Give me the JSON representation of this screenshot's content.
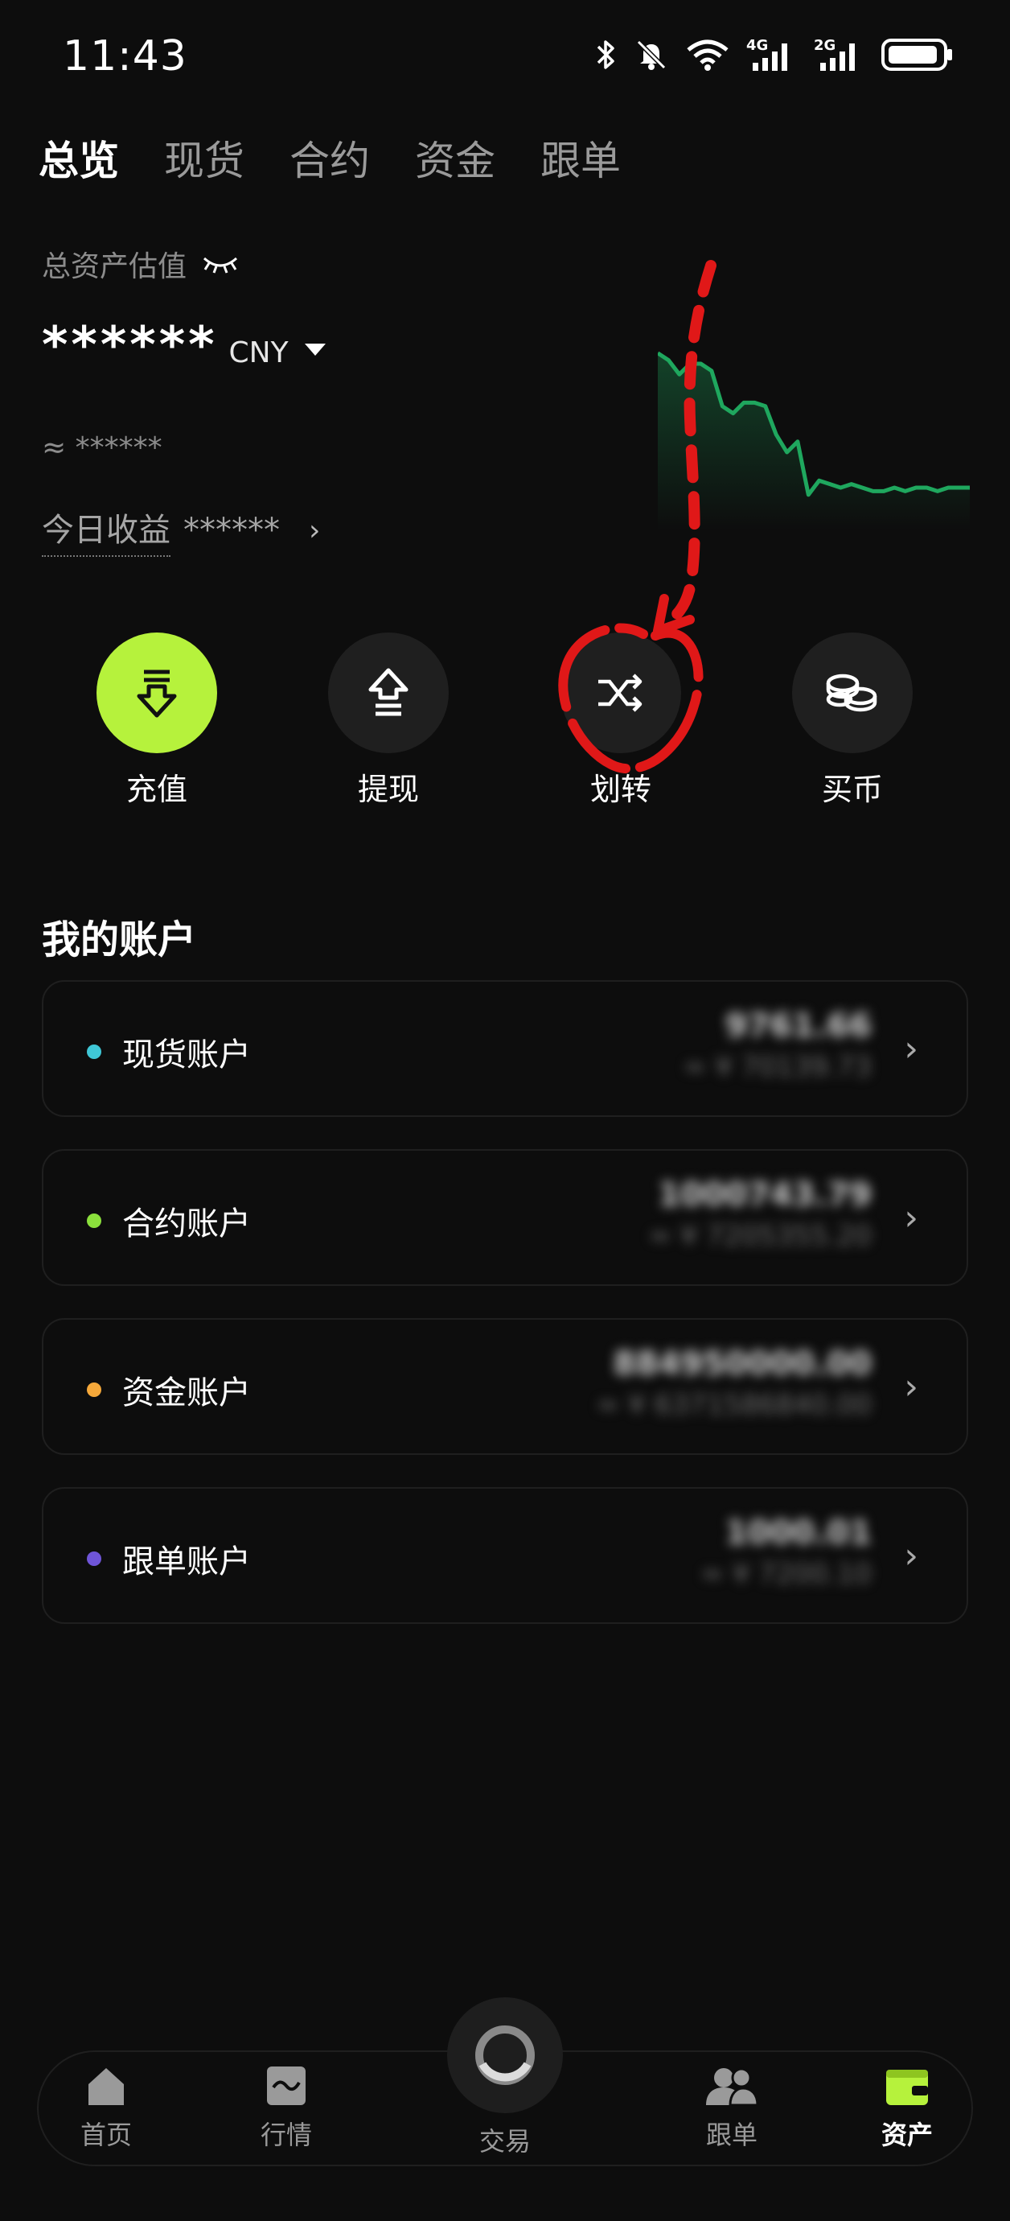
{
  "status_bar": {
    "time": "11:43",
    "icons": [
      "bluetooth-icon",
      "mute-icon",
      "wifi-icon",
      "signal-4g-icon",
      "signal-2g-icon",
      "battery-icon"
    ],
    "signal_4g": "4G",
    "signal_2g": "2G"
  },
  "tabs": [
    "总览",
    "现货",
    "合约",
    "资金",
    "跟单"
  ],
  "active_tab": "总览",
  "summary": {
    "label": "总资产估值",
    "amount": "******",
    "currency": "CNY",
    "approx": "≈ ******",
    "today_label": "今日收益",
    "today_value": "******"
  },
  "actions": [
    {
      "label": "充值",
      "icon": "deposit-icon"
    },
    {
      "label": "提现",
      "icon": "withdraw-icon"
    },
    {
      "label": "划转",
      "icon": "transfer-icon"
    },
    {
      "label": "买币",
      "icon": "buy-coin-icon"
    }
  ],
  "accounts_title": "我的账户",
  "accounts": [
    {
      "name": "现货账户",
      "dot_color": "#3fc7d6",
      "main": "9761.66",
      "sub": "≈ ¥ 70139.73"
    },
    {
      "name": "合约账户",
      "dot_color": "#8be03c",
      "main": "1000743.79",
      "sub": "≈ ¥ 7205355.20"
    },
    {
      "name": "资金账户",
      "dot_color": "#f5a83a",
      "main": "884950000.00",
      "sub": "≈ ¥ 6371586840.00"
    },
    {
      "name": "跟单账户",
      "dot_color": "#6f55d8",
      "main": "1000.01",
      "sub": "≈ ¥ 7200.10"
    }
  ],
  "bottom_nav": [
    {
      "label": "首页",
      "icon": "home-icon"
    },
    {
      "label": "行情",
      "icon": "market-icon"
    },
    {
      "label": "交易",
      "icon": "trade-icon"
    },
    {
      "label": "跟单",
      "icon": "copy-trade-icon"
    },
    {
      "label": "资产",
      "icon": "wallet-icon"
    }
  ],
  "active_nav": "资产",
  "colors": {
    "background": "#0d0d0d",
    "accent": "#b6f23c",
    "chart_line": "#1fa75e",
    "annotation": "#e01818"
  },
  "chart_data": {
    "type": "area",
    "x": [
      0,
      1,
      2,
      3,
      4,
      5,
      6,
      7,
      8,
      9,
      10,
      11,
      12,
      13,
      14,
      15,
      16,
      17,
      18,
      19,
      20,
      21,
      22,
      23,
      24,
      25,
      26,
      27,
      28,
      29
    ],
    "values": [
      78,
      76,
      72,
      75,
      75,
      73,
      63,
      61,
      64,
      64,
      63,
      55,
      50,
      53,
      38,
      42,
      41,
      40,
      41,
      40,
      39,
      39,
      40,
      39,
      40,
      40,
      39,
      40,
      40,
      40
    ],
    "xlabel": "",
    "ylabel": "",
    "grid": false
  }
}
